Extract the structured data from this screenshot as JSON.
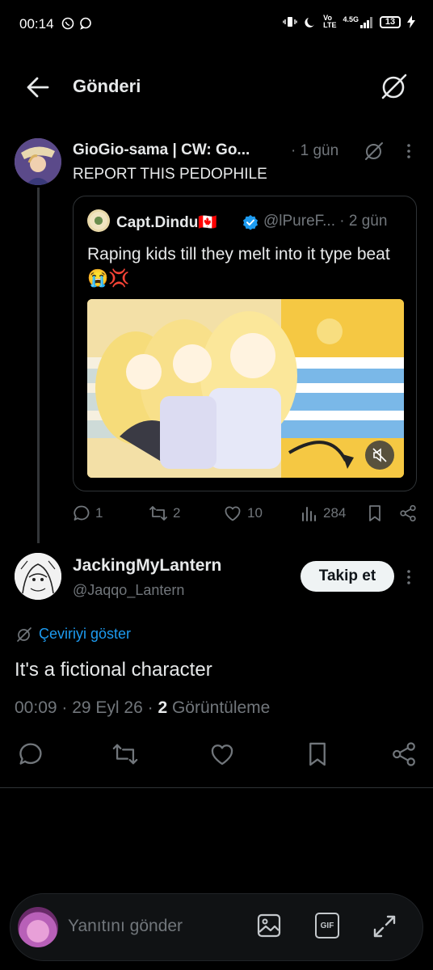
{
  "status_bar": {
    "time": "00:14",
    "network_top": "Vo",
    "network_bottom": "LTE",
    "signal": "4.5G",
    "battery": "13"
  },
  "header": {
    "title": "Gönderi"
  },
  "parent_post": {
    "author": "GioGio-sama | CW: Go...",
    "time": "· 1 gün",
    "text": "REPORT THIS PEDOPHILE",
    "quote": {
      "author": "Capt.Dindu🇨🇦",
      "handle": "@lPureF...",
      "time": "· 2 gün",
      "text": "Raping kids till they melt into it type beat 😭💢"
    },
    "stats": {
      "replies": "1",
      "reposts": "2",
      "likes": "10",
      "views": "284"
    }
  },
  "main_post": {
    "author": "JackingMyLantern",
    "handle": "@Jaqqo_Lantern",
    "follow_label": "Takip et",
    "translate_label": "Çeviriyi göster",
    "text": "It's a fictional character",
    "meta_prefix": "00:09 · 29 Eyl 26 · ",
    "views_count": "2",
    "views_label": " Görüntüleme"
  },
  "composer": {
    "placeholder": "Yanıtını gönder",
    "gif_label": "GIF"
  },
  "colors": {
    "accent": "#1d9bf0",
    "muted": "#71767b",
    "text": "#e7e9ea",
    "background": "#000000"
  }
}
